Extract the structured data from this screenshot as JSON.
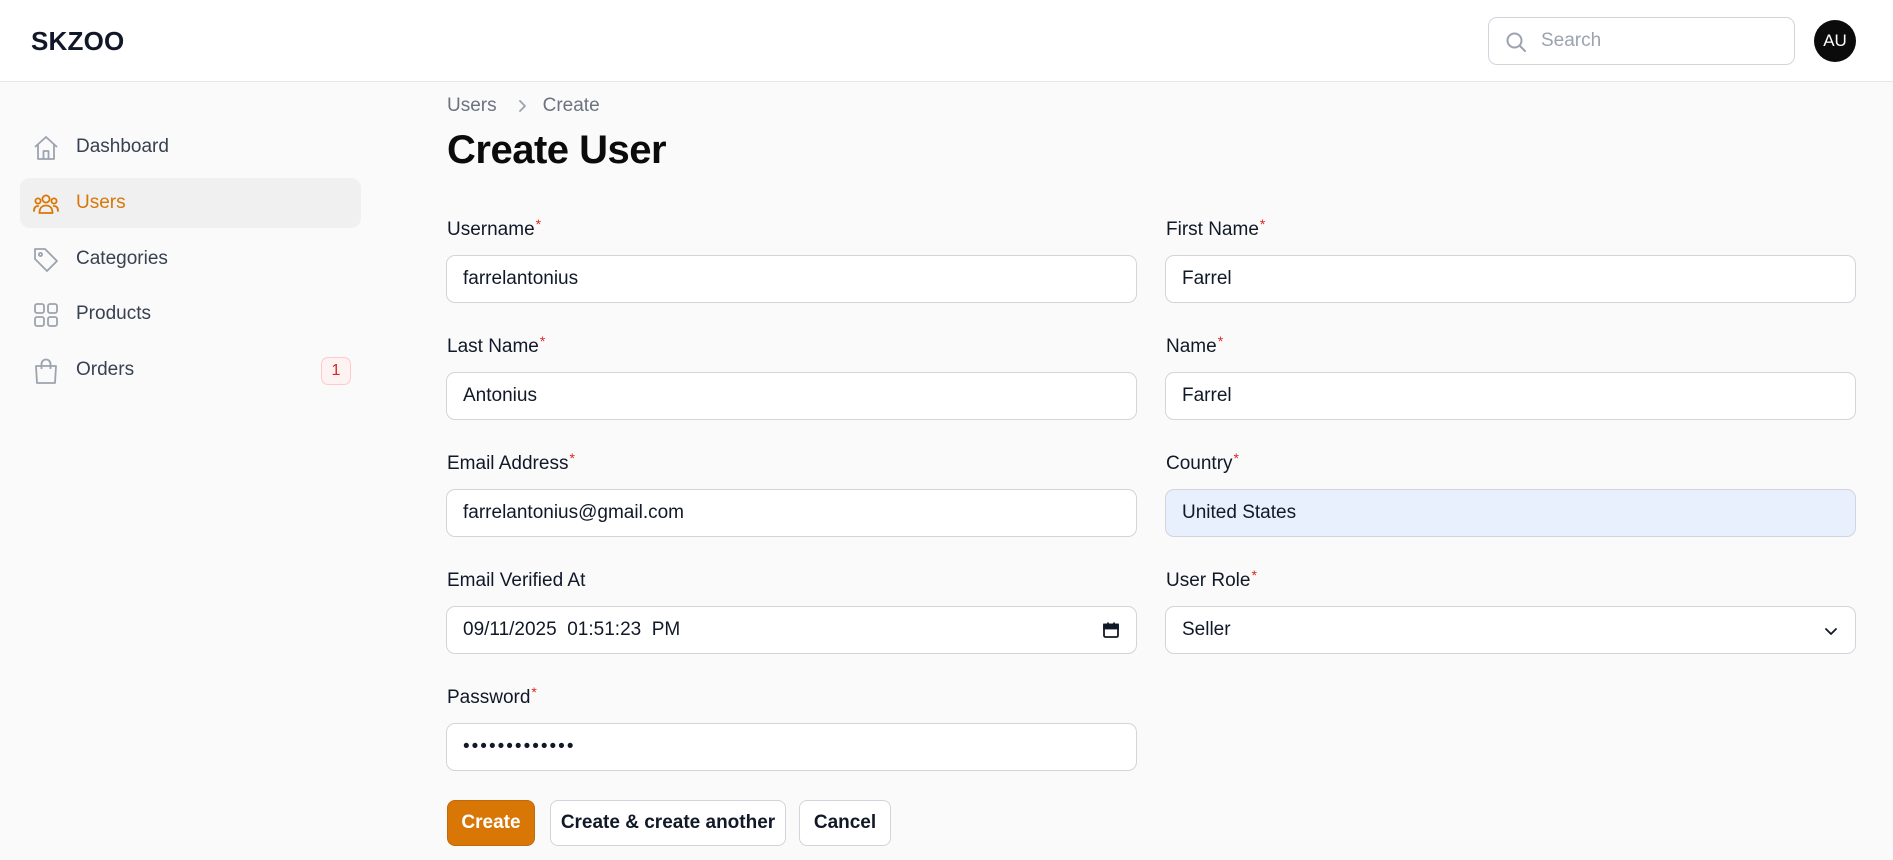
{
  "app": {
    "brand": "SKZOO"
  },
  "header": {
    "search_placeholder": "Search",
    "avatar_initials": "AU"
  },
  "sidebar": {
    "items": [
      {
        "label": "Dashboard",
        "icon": "home-icon",
        "active": false
      },
      {
        "label": "Users",
        "icon": "users-icon",
        "active": true
      },
      {
        "label": "Categories",
        "icon": "tag-icon",
        "active": false
      },
      {
        "label": "Products",
        "icon": "grid-icon",
        "active": false
      },
      {
        "label": "Orders",
        "icon": "shopping-bag-icon",
        "active": false,
        "badge": "1"
      }
    ]
  },
  "breadcrumb": {
    "parent": "Users",
    "current": "Create"
  },
  "page": {
    "title": "Create User"
  },
  "form": {
    "username": {
      "label": "Username",
      "required": "*",
      "value": "farrelantonius"
    },
    "first_name": {
      "label": "First Name",
      "required": "*",
      "value": "Farrel"
    },
    "last_name": {
      "label": "Last Name",
      "required": "*",
      "value": "Antonius"
    },
    "name": {
      "label": "Name",
      "required": "*",
      "value": "Farrel"
    },
    "email": {
      "label": "Email Address",
      "required": "*",
      "value": "farrelantonius@gmail.com"
    },
    "country": {
      "label": "Country",
      "required": "*",
      "value": "United States"
    },
    "email_verified_at": {
      "label": "Email Verified At",
      "value": "09/11/2025  01:51:23  PM"
    },
    "user_role": {
      "label": "User Role",
      "required": "*",
      "value": "Seller"
    },
    "password": {
      "label": "Password",
      "required": "*",
      "value": "farrel2025abc"
    }
  },
  "actions": {
    "create": "Create",
    "create_another": "Create & create another",
    "cancel": "Cancel"
  },
  "colors": {
    "accent": "#d97706",
    "required": "#dc2626",
    "badge_bg": "#fef2f2",
    "autofill_bg": "#e8f0fe"
  }
}
